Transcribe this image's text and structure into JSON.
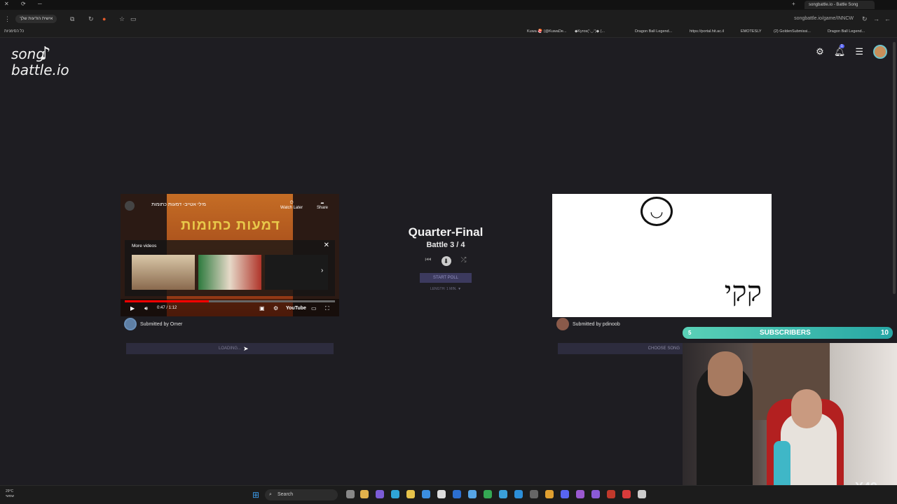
{
  "browser": {
    "active_tab": "songbattle.io - Battle Song",
    "url": "songbattle.io/game/INNCW",
    "profile_chip": "אישית הודעות שלך",
    "bookmarks_left": "כל הסימניות",
    "bookmarks": [
      "Kuwa 🍣 (@KuwaDe...",
      "◆Kyros(ᵔ◡ᵔ)◆ (...",
      "Dragon Ball Legend...",
      "https://portal.hit.ac.il",
      "EMOTESLY",
      "(2) GoldenSubmissi...",
      "Dragon Ball Legend..."
    ]
  },
  "site": {
    "logo_line1": "song",
    "logo_line2": "battle.io",
    "notification_count": "1"
  },
  "left_song": {
    "video_title": "מילי אטייב- דמעות כתומות",
    "banner_text": "דמעות כתומות",
    "watch_later": "Watch Later",
    "share": "Share",
    "more_videos": "More videos",
    "time": "0:47 / 1:12",
    "youtube": "YouTube",
    "submitted_by": "Submitted by Omer",
    "bar_label": "LOADING..."
  },
  "center": {
    "round": "Quarter-Final",
    "battle": "Battle 3 / 4",
    "start_poll": "START POLL",
    "length": "LENGTH: 1 MIN. ▼"
  },
  "right_song": {
    "hebrew_text": "קקי",
    "submitted_by": "Submitted by pdinoob",
    "bar_label": "CHOOSE SONG"
  },
  "overlay": {
    "subs_current": "5",
    "subs_label": "SUBSCRIBERS",
    "subs_goal": "10",
    "multiplier": "X49"
  },
  "taskbar": {
    "weather_temp": "29°C",
    "weather_desc": "שמשי",
    "search": "Search"
  }
}
